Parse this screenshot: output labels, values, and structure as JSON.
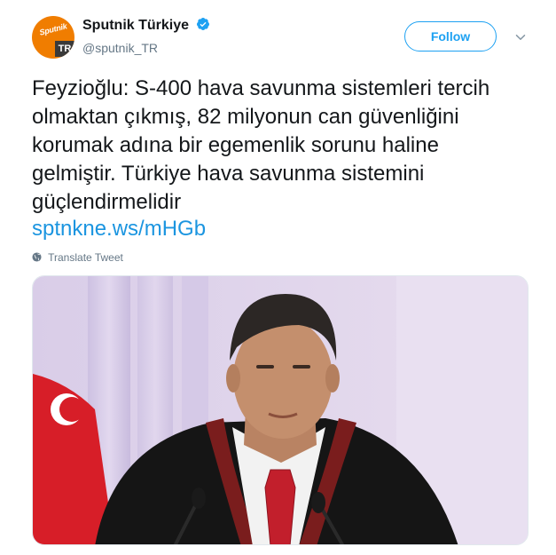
{
  "tweet": {
    "avatar": {
      "logo_top": "Sputnik",
      "logo_bottom": "TR"
    },
    "display_name": "Sputnik Türkiye",
    "verified": true,
    "handle": "@sputnik_TR",
    "follow_label": "Follow",
    "text": "Feyzioğlu: S-400 hava savunma sistemleri tercih olmaktan çıkmış, 82 milyonun can güvenliğini korumak adına bir egemenlik sorunu haline gelmiştir. Türkiye hava savunma sistemini güçlendirmelidir",
    "link": "sptnkne.ws/mHGb",
    "translate_label": "Translate Tweet",
    "media": {
      "icon": "photo"
    }
  },
  "colors": {
    "accent": "#1da1f2",
    "link": "#1b95e0",
    "secondary_text": "#657786",
    "brand_orange": "#f07d00"
  }
}
